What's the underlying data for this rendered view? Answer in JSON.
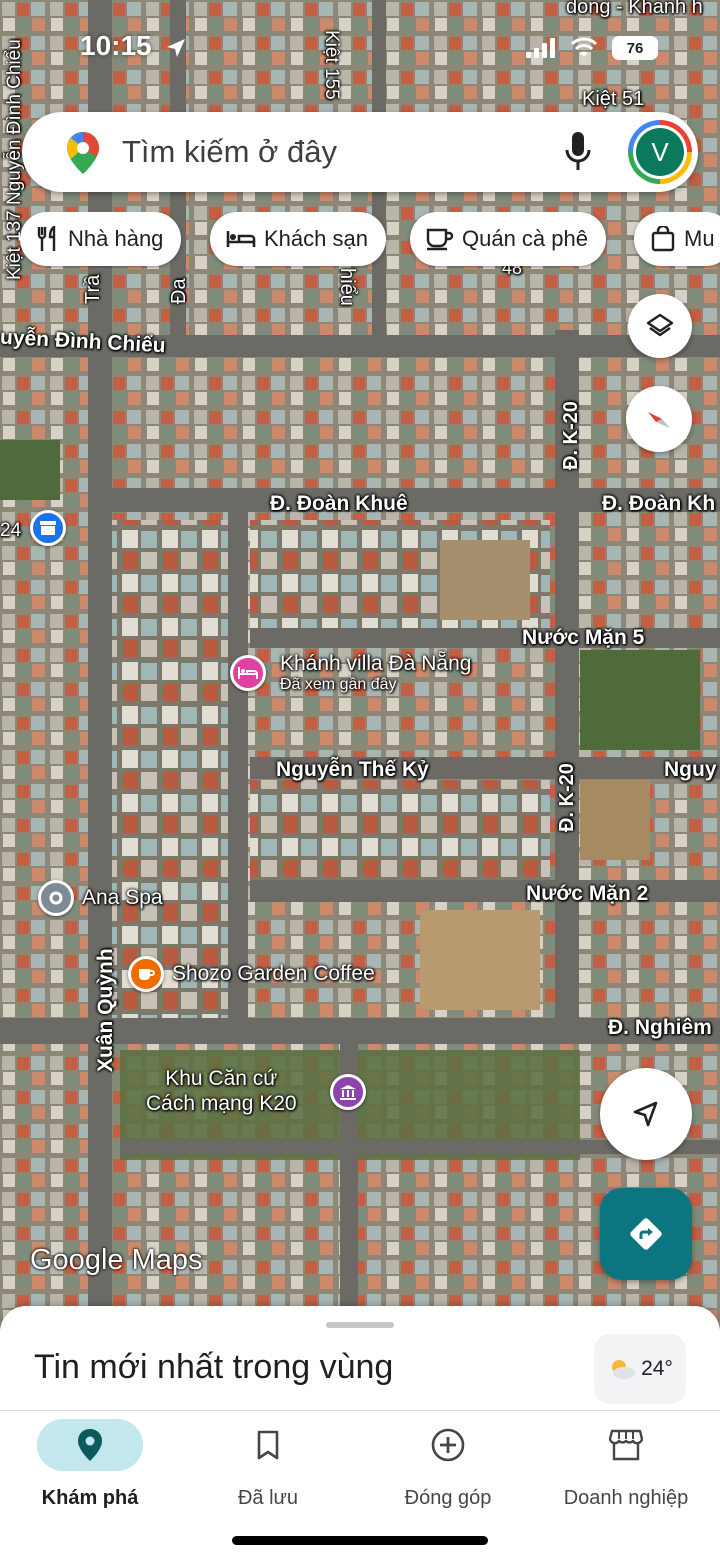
{
  "status_bar": {
    "time": "10:15",
    "battery": "76"
  },
  "search": {
    "placeholder": "Tìm kiếm ở đây",
    "avatar_letter": "V"
  },
  "chips": [
    {
      "label": "Nhà hàng",
      "icon": "fork-knife-icon"
    },
    {
      "label": "Khách sạn",
      "icon": "bed-icon"
    },
    {
      "label": "Quán cà phê",
      "icon": "coffee-cup-icon"
    },
    {
      "label": "Mu",
      "icon": "shopping-bag-icon"
    }
  ],
  "map": {
    "streets": {
      "kiet137": "Kiệt 137 Nguyễn Đình Chiểu",
      "kiet155": "Kiệt 155",
      "kiet51": "Kiệt 51",
      "dong_khanh": "dong - Khanh h",
      "nguyen_dinh_chieu": "uyễn Đình Chiểu",
      "chieu_vert": "hiểu",
      "tran_vert": "Trầ",
      "da_vert": "Đa",
      "num48": "48",
      "k20_a": "Đ. K-20",
      "k20_b": "Đ. K-20",
      "doan_khue": "Đ. Đoàn Khuê",
      "doan_khue_r": "Đ. Đoàn Kh",
      "nuoc_man_5": "Nước Mặn 5",
      "nguyen_the_ky": "Nguyễn Thế Kỷ",
      "nguy_r": "Nguy",
      "nuoc_man_2": "Nước Mặn 2",
      "nghiem_r": "Đ. Nghiêm",
      "xuan_quynh": "Xuân Quỳnh",
      "num24": "24"
    },
    "pois": {
      "khanh_villa": {
        "name": "Khánh villa Đà Nẵng",
        "sub": "Đã xem gần đây"
      },
      "ana_spa": {
        "name": "Ana Spa"
      },
      "shozo": {
        "name": "Shozo Garden Coffee"
      },
      "khu_can_cu": {
        "line1": "Khu Căn cứ",
        "line2": "Cách mạng K20"
      }
    },
    "watermark": "Google Maps",
    "colors": {
      "hotel_pin": "#e040a0",
      "cafe_pin": "#ef6c00",
      "spa_pin": "#7e8a94",
      "museum_pin": "#8e44ad",
      "shop_pin": "#1a73e8"
    }
  },
  "sheet": {
    "title": "Tin mới nhất trong vùng",
    "temperature": "24°"
  },
  "nav": [
    {
      "label": "Khám phá",
      "icon": "explore-pin-icon",
      "active": true
    },
    {
      "label": "Đã lưu",
      "icon": "bookmark-icon",
      "active": false
    },
    {
      "label": "Đóng góp",
      "icon": "add-circle-icon",
      "active": false
    },
    {
      "label": "Doanh nghiệp",
      "icon": "storefront-icon",
      "active": false
    }
  ]
}
